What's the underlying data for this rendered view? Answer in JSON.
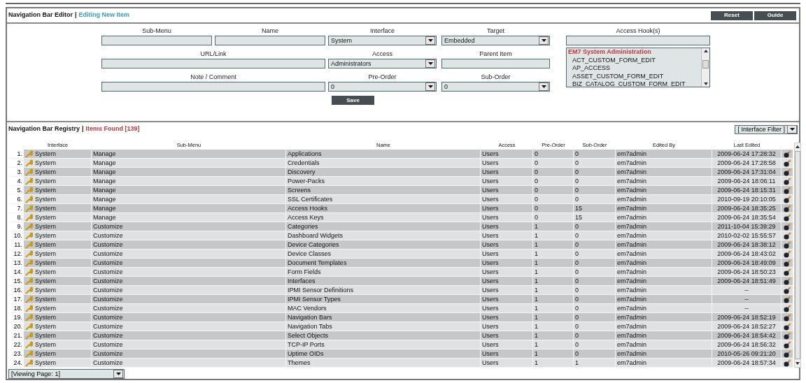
{
  "editor": {
    "title": "Navigation Bar Editor",
    "separator": "|",
    "subtitle": "Editing New Item",
    "buttons": [
      "Reset",
      "Guide"
    ],
    "fields": {
      "sub_menu": {
        "label": "Sub-Menu"
      },
      "name": {
        "label": "Name"
      },
      "interface": {
        "label": "Interface",
        "value": "System"
      },
      "target": {
        "label": "Target",
        "value": "Embedded"
      },
      "url": {
        "label": "URL/Link"
      },
      "access": {
        "label": "Access",
        "value": "Administrators"
      },
      "parent": {
        "label": "Parent Item"
      },
      "note": {
        "label": "Note / Comment"
      },
      "pre_order": {
        "label": "Pre-Order",
        "value": "0"
      },
      "sub_order": {
        "label": "Sub-Order",
        "value": "0"
      }
    },
    "access_hooks": {
      "label": "Access Hook(s)",
      "group": "EM7 System Administration",
      "items": [
        "ACT_CUSTOM_FORM_EDIT",
        "AP_ACCESS",
        "ASSET_CUSTOM_FORM_EDIT",
        "BIZ_CATALOG_CUSTOM_FORM_EDIT"
      ]
    },
    "save": "Save"
  },
  "registry": {
    "title": "Navigation Bar Registry",
    "separator": "|",
    "count": "Items Found [139]",
    "filter": "[ Interface Filter ]",
    "columns": [
      "Interface",
      "Sub-Menu",
      "Name",
      "Access",
      "Pre-Order",
      "Sub-Order",
      "Edited By",
      "Last Edited"
    ],
    "rows": [
      {
        "number": "1.",
        "cells": [
          "System",
          "Manage",
          "Applications",
          "Users",
          "0",
          "0",
          "em7admin",
          "2009-06-24 17:28:32"
        ]
      },
      {
        "number": "2.",
        "cells": [
          "System",
          "Manage",
          "Credentials",
          "Users",
          "0",
          "0",
          "em7admin",
          "2009-06-24 17:28:58"
        ]
      },
      {
        "number": "3.",
        "cells": [
          "System",
          "Manage",
          "Discovery",
          "Users",
          "0",
          "0",
          "em7admin",
          "2009-06-24 17:31:04"
        ]
      },
      {
        "number": "4.",
        "cells": [
          "System",
          "Manage",
          "Power-Packs",
          "Users",
          "0",
          "0",
          "em7admin",
          "2009-06-24 18:06:11"
        ]
      },
      {
        "number": "5.",
        "cells": [
          "System",
          "Manage",
          "Screens",
          "Users",
          "0",
          "0",
          "em7admin",
          "2009-06-24 18:15:31"
        ]
      },
      {
        "number": "6.",
        "cells": [
          "System",
          "Manage",
          "SSL Certificates",
          "Users",
          "0",
          "0",
          "em7admin",
          "2010-09-19 20:10:05"
        ]
      },
      {
        "number": "7.",
        "cells": [
          "System",
          "Manage",
          "Access Hooks",
          "Users",
          "0",
          "15",
          "em7admin",
          "2009-06-24 18:35:25"
        ]
      },
      {
        "number": "8.",
        "cells": [
          "System",
          "Manage",
          "Access Keys",
          "Users",
          "0",
          "15",
          "em7admin",
          "2009-06-24 18:35:54"
        ]
      },
      {
        "number": "9.",
        "cells": [
          "System",
          "Customize",
          "Categories",
          "Users",
          "1",
          "0",
          "em7admin",
          "2011-10-04 15:39:29"
        ]
      },
      {
        "number": "10.",
        "cells": [
          "System",
          "Customize",
          "Dashboard Widgets",
          "Users",
          "1",
          "0",
          "em7admin",
          "2010-02-02 15:55:57"
        ]
      },
      {
        "number": "11.",
        "cells": [
          "System",
          "Customize",
          "Device Categories",
          "Users",
          "1",
          "0",
          "em7admin",
          "2009-06-24 18:38:12"
        ]
      },
      {
        "number": "12.",
        "cells": [
          "System",
          "Customize",
          "Device Classes",
          "Users",
          "1",
          "0",
          "em7admin",
          "2009-06-24 18:43:02"
        ]
      },
      {
        "number": "13.",
        "cells": [
          "System",
          "Customize",
          "Document Templates",
          "Users",
          "1",
          "0",
          "em7admin",
          "2009-06-24 18:49:09"
        ]
      },
      {
        "number": "14.",
        "cells": [
          "System",
          "Customize",
          "Form Fields",
          "Users",
          "1",
          "0",
          "em7admin",
          "2009-06-24 18:50:23"
        ]
      },
      {
        "number": "15.",
        "cells": [
          "System",
          "Customize",
          "Interfaces",
          "Users",
          "1",
          "0",
          "em7admin",
          "2009-06-24 18:51:49"
        ]
      },
      {
        "number": "16.",
        "cells": [
          "System",
          "Customize",
          "IPMI Sensor Definitions",
          "Users",
          "1",
          "0",
          "em7admin",
          "--"
        ]
      },
      {
        "number": "17.",
        "cells": [
          "System",
          "Customize",
          "IPMI Sensor Types",
          "Users",
          "1",
          "0",
          "em7admin",
          "--"
        ]
      },
      {
        "number": "18.",
        "cells": [
          "System",
          "Customize",
          "MAC Vendors",
          "Users",
          "1",
          "0",
          "em7admin",
          "--"
        ]
      },
      {
        "number": "19.",
        "cells": [
          "System",
          "Customize",
          "Navigation Bars",
          "Users",
          "1",
          "0",
          "em7admin",
          "2009-06-24 18:52:19"
        ]
      },
      {
        "number": "20.",
        "cells": [
          "System",
          "Customize",
          "Navigation Tabs",
          "Users",
          "1",
          "0",
          "em7admin",
          "2009-06-24 18:52:27"
        ]
      },
      {
        "number": "21.",
        "cells": [
          "System",
          "Customize",
          "Select Objects",
          "Users",
          "1",
          "0",
          "em7admin",
          "2009-06-24 18:54:42"
        ]
      },
      {
        "number": "22.",
        "cells": [
          "System",
          "Customize",
          "TCP-IP Ports",
          "Users",
          "1",
          "0",
          "em7admin",
          "2009-06-24 18:56:32"
        ]
      },
      {
        "number": "23.",
        "cells": [
          "System",
          "Customize",
          "Uptime OIDs",
          "Users",
          "1",
          "0",
          "em7admin",
          "2010-05-26 09:21:20"
        ]
      },
      {
        "number": "24.",
        "cells": [
          "System",
          "Customize",
          "Themes",
          "Users",
          "1",
          "1",
          "em7admin",
          "2009-06-24 18:57:34"
        ]
      }
    ],
    "pager": "[Viewing Page: 1]"
  }
}
